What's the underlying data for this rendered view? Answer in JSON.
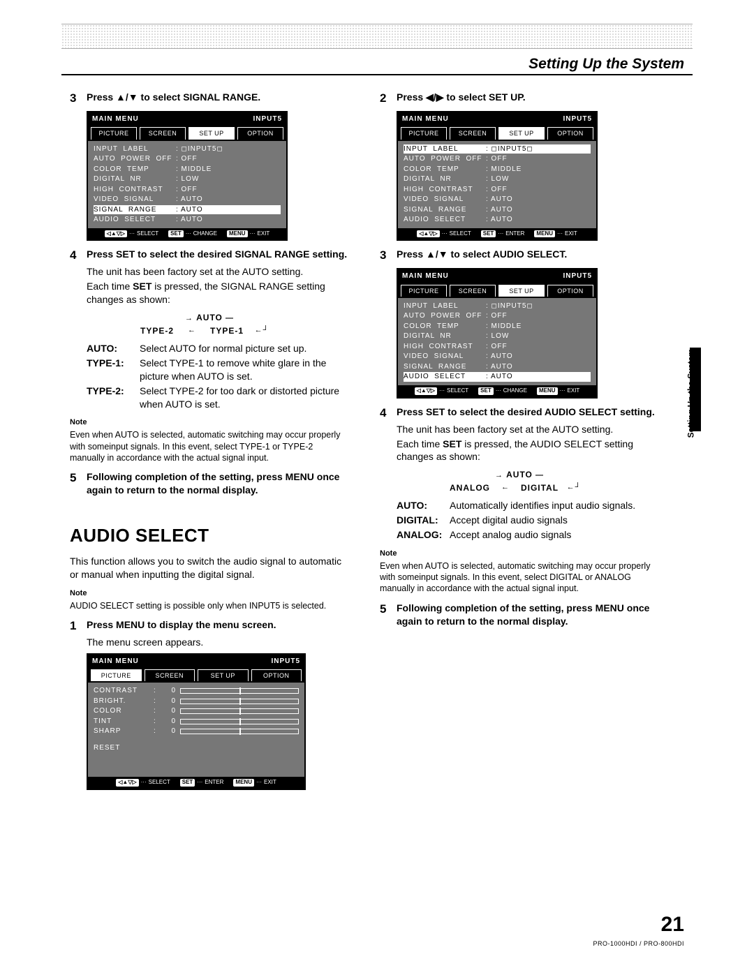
{
  "header": {
    "title": "Setting Up the System"
  },
  "thumb": "Setting Up the System",
  "page_number": "21",
  "model": "PRO-1000HDI / PRO-800HDI",
  "osd": {
    "main": "MAIN  MENU",
    "input": "INPUT5",
    "tabs": [
      "PICTURE",
      "SCREEN",
      "SET UP",
      "OPTION"
    ],
    "rows": [
      {
        "k": "INPUT  LABEL",
        "v": ": ◻INPUT5◻"
      },
      {
        "k": "AUTO  POWER  OFF",
        "v": ": OFF"
      },
      {
        "k": "COLOR  TEMP",
        "v": ": MIDDLE"
      },
      {
        "k": "DIGITAL  NR",
        "v": ": LOW"
      },
      {
        "k": "HIGH  CONTRAST",
        "v": ": OFF"
      },
      {
        "k": "VIDEO  SIGNAL",
        "v": ": AUTO"
      },
      {
        "k": "SIGNAL  RANGE",
        "v": ": AUTO"
      },
      {
        "k": "AUDIO  SELECT",
        "v": ": AUTO"
      }
    ],
    "foot_select": "SELECT",
    "foot_change": "CHANGE",
    "foot_enter": "ENTER",
    "foot_exit": "EXIT",
    "key_set": "SET",
    "key_menu": "MENU",
    "key_arrows": "◁▲▽▷"
  },
  "osd_pic": {
    "rows": [
      {
        "k": "CONTRAST",
        "v": "0"
      },
      {
        "k": "BRIGHT.",
        "v": "0"
      },
      {
        "k": "COLOR",
        "v": "0"
      },
      {
        "k": "TINT",
        "v": "0"
      },
      {
        "k": "SHARP",
        "v": "0"
      }
    ],
    "reset": "RESET"
  },
  "left": {
    "s3": "Press ▲/▼ to select SIGNAL RANGE.",
    "s4": "Press SET to select the desired SIGNAL RANGE setting.",
    "s4b1": "The unit has been factory set at the AUTO setting.",
    "s4b2a": "Each time ",
    "s4b2b": "SET",
    "s4b2c": " is pressed, the SIGNAL RANGE setting changes as shown:",
    "cycle": {
      "top": "AUTO",
      "l": "TYPE-2",
      "r": "TYPE-1"
    },
    "d_auto_k": "AUTO:",
    "d_auto_v": "Select AUTO for normal picture set up.",
    "d_t1_k": "TYPE-1:",
    "d_t1_v": "Select TYPE-1 to remove white glare in the picture when AUTO is set.",
    "d_t2_k": "TYPE-2:",
    "d_t2_v": "Select TYPE-2 for too dark or distorted picture when AUTO is set.",
    "note_h": "Note",
    "note_b": "Even when AUTO is selected, automatic switching may occur properly with someinput signals. In this event, select TYPE-1 or TYPE-2 manually in accordance with the actual signal input.",
    "s5": "Following completion of the setting, press MENU once again to return to the normal display.",
    "h2": "AUDIO SELECT",
    "intro": "This function allows you to switch the audio signal to automatic or manual when inputting the digital signal.",
    "note2_b": "AUDIO SELECT setting is possible only when INPUT5 is selected.",
    "s1": "Press MENU to display the menu screen.",
    "s1b": "The menu screen appears."
  },
  "right": {
    "s2": "Press ◀/▶ to select SET UP.",
    "s3": "Press ▲/▼ to select AUDIO SELECT.",
    "s4": "Press SET to select the desired AUDIO SELECT setting.",
    "s4b1": "The unit has been factory set at the AUTO setting.",
    "s4b2a": "Each time ",
    "s4b2b": "SET",
    "s4b2c": " is pressed, the AUDIO SELECT setting changes as shown:",
    "cycle": {
      "top": "AUTO",
      "l": "ANALOG",
      "r": "DIGITAL"
    },
    "d_auto_k": "AUTO:",
    "d_auto_v": "Automatically identifies input audio signals.",
    "d_dig_k": "DIGITAL:",
    "d_dig_v": "Accept digital audio signals",
    "d_ana_k": "ANALOG:",
    "d_ana_v": "Accept analog audio signals",
    "note_h": "Note",
    "note_b": "Even when AUTO is selected, automatic switching may occur properly with someinput signals. In this event, select DIGITAL or ANALOG manually in accordance with the actual signal input.",
    "s5": "Following completion of the setting, press MENU once again to return to the normal display."
  }
}
